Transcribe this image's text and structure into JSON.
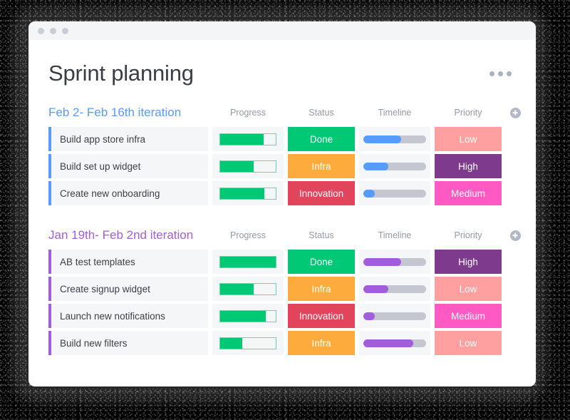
{
  "window": {
    "traffic_lights": [
      "close-dot",
      "minimize-dot",
      "maximize-dot"
    ]
  },
  "header": {
    "title": "Sprint planning",
    "menu_icon": "kebab-menu-icon"
  },
  "columns": {
    "progress": "Progress",
    "status": "Status",
    "timeline": "Timeline",
    "priority": "Priority",
    "add_icon": "plus-circle-icon"
  },
  "colors": {
    "accent_blue": "#579bfc",
    "accent_purple": "#a25ddc",
    "green": "#00c875",
    "green_outline": "#66d9a6",
    "orange": "#fdab3d",
    "red": "#e2445c",
    "salmon": "#ffa0a0",
    "dark_purple": "#7e3b8e",
    "pink": "#ff5ac4",
    "track_gray": "#c5c7d0",
    "row_bg": "#f5f6f8",
    "header_text": "#9699a6"
  },
  "sections": [
    {
      "title": "Feb 2- Feb 16th iteration",
      "accent": "blue",
      "rows": [
        {
          "task": "Build app store infra",
          "progress": 78,
          "status": {
            "label": "Done",
            "color": "#00c875"
          },
          "timeline": 60,
          "priority": {
            "label": "Low",
            "color": "#ffa0a0"
          }
        },
        {
          "task": "Build set up widget",
          "progress": 60,
          "status": {
            "label": "Infra",
            "color": "#fdab3d"
          },
          "timeline": 40,
          "priority": {
            "label": "High",
            "color": "#7e3b8e"
          }
        },
        {
          "task": "Create new onboarding",
          "progress": 80,
          "status": {
            "label": "Innovation",
            "color": "#e2445c"
          },
          "timeline": 18,
          "priority": {
            "label": "Medium",
            "color": "#ff5ac4"
          }
        }
      ]
    },
    {
      "title": "Jan 19th- Feb 2nd iteration",
      "accent": "purple",
      "rows": [
        {
          "task": "AB test templates",
          "progress": 100,
          "status": {
            "label": "Done",
            "color": "#00c875"
          },
          "timeline": 60,
          "priority": {
            "label": "High",
            "color": "#7e3b8e"
          }
        },
        {
          "task": "Create signup widget",
          "progress": 60,
          "status": {
            "label": "Infra",
            "color": "#fdab3d"
          },
          "timeline": 40,
          "priority": {
            "label": "Low",
            "color": "#ffa0a0"
          }
        },
        {
          "task": "Launch new notifications",
          "progress": 82,
          "status": {
            "label": "Innovation",
            "color": "#e2445c"
          },
          "timeline": 18,
          "priority": {
            "label": "Medium",
            "color": "#ff5ac4"
          }
        },
        {
          "task": "Build new filters",
          "progress": 40,
          "status": {
            "label": "Infra",
            "color": "#fdab3d"
          },
          "timeline": 80,
          "priority": {
            "label": "Low",
            "color": "#ffa0a0"
          }
        }
      ]
    }
  ]
}
